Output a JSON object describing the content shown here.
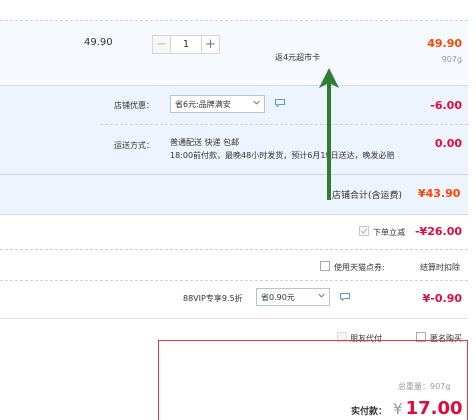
{
  "item": {
    "unit_price": "49.90",
    "quantity": "1",
    "minus_symbol": "−",
    "plus_symbol": "+",
    "rebate_text": "返4元超市卡",
    "total": "49.90",
    "weight": "907g"
  },
  "shop": {
    "discount_label": "店铺优惠：",
    "discount_select": "省6元:品牌满安",
    "discount_amount": "-6.00",
    "shipping_label": "运送方式：",
    "shipping_method": "普通配送 快递 包邮",
    "shipping_note": "18:00前付款，最晚48小时发货，预计6月19日送达，晚发必赔",
    "shipping_amount": "0.00",
    "total_label": "店铺合计(含运费)",
    "total_value": "¥43.90"
  },
  "order": {
    "instant_discount_label": "下单立减",
    "instant_discount_value": "-¥26.00",
    "coupon_label": "使用天猫点券:",
    "coupon_note": "结算时扣除",
    "vip_label": "88VIP专享9.5折",
    "vip_select": "省0.90元",
    "vip_amount": "¥-0.90",
    "friend_pay_label": "朋友代付",
    "anonymous_label": "匿名购买"
  },
  "summary": {
    "total_weight_label": "总重量：",
    "total_weight_value": "907g",
    "pay_label": "实付款：",
    "currency": "¥",
    "pay_value": "17.00"
  },
  "colors": {
    "accent_red": "#e4093c",
    "accent_orange": "#ff4400",
    "arrow_green": "#2e7d32"
  }
}
